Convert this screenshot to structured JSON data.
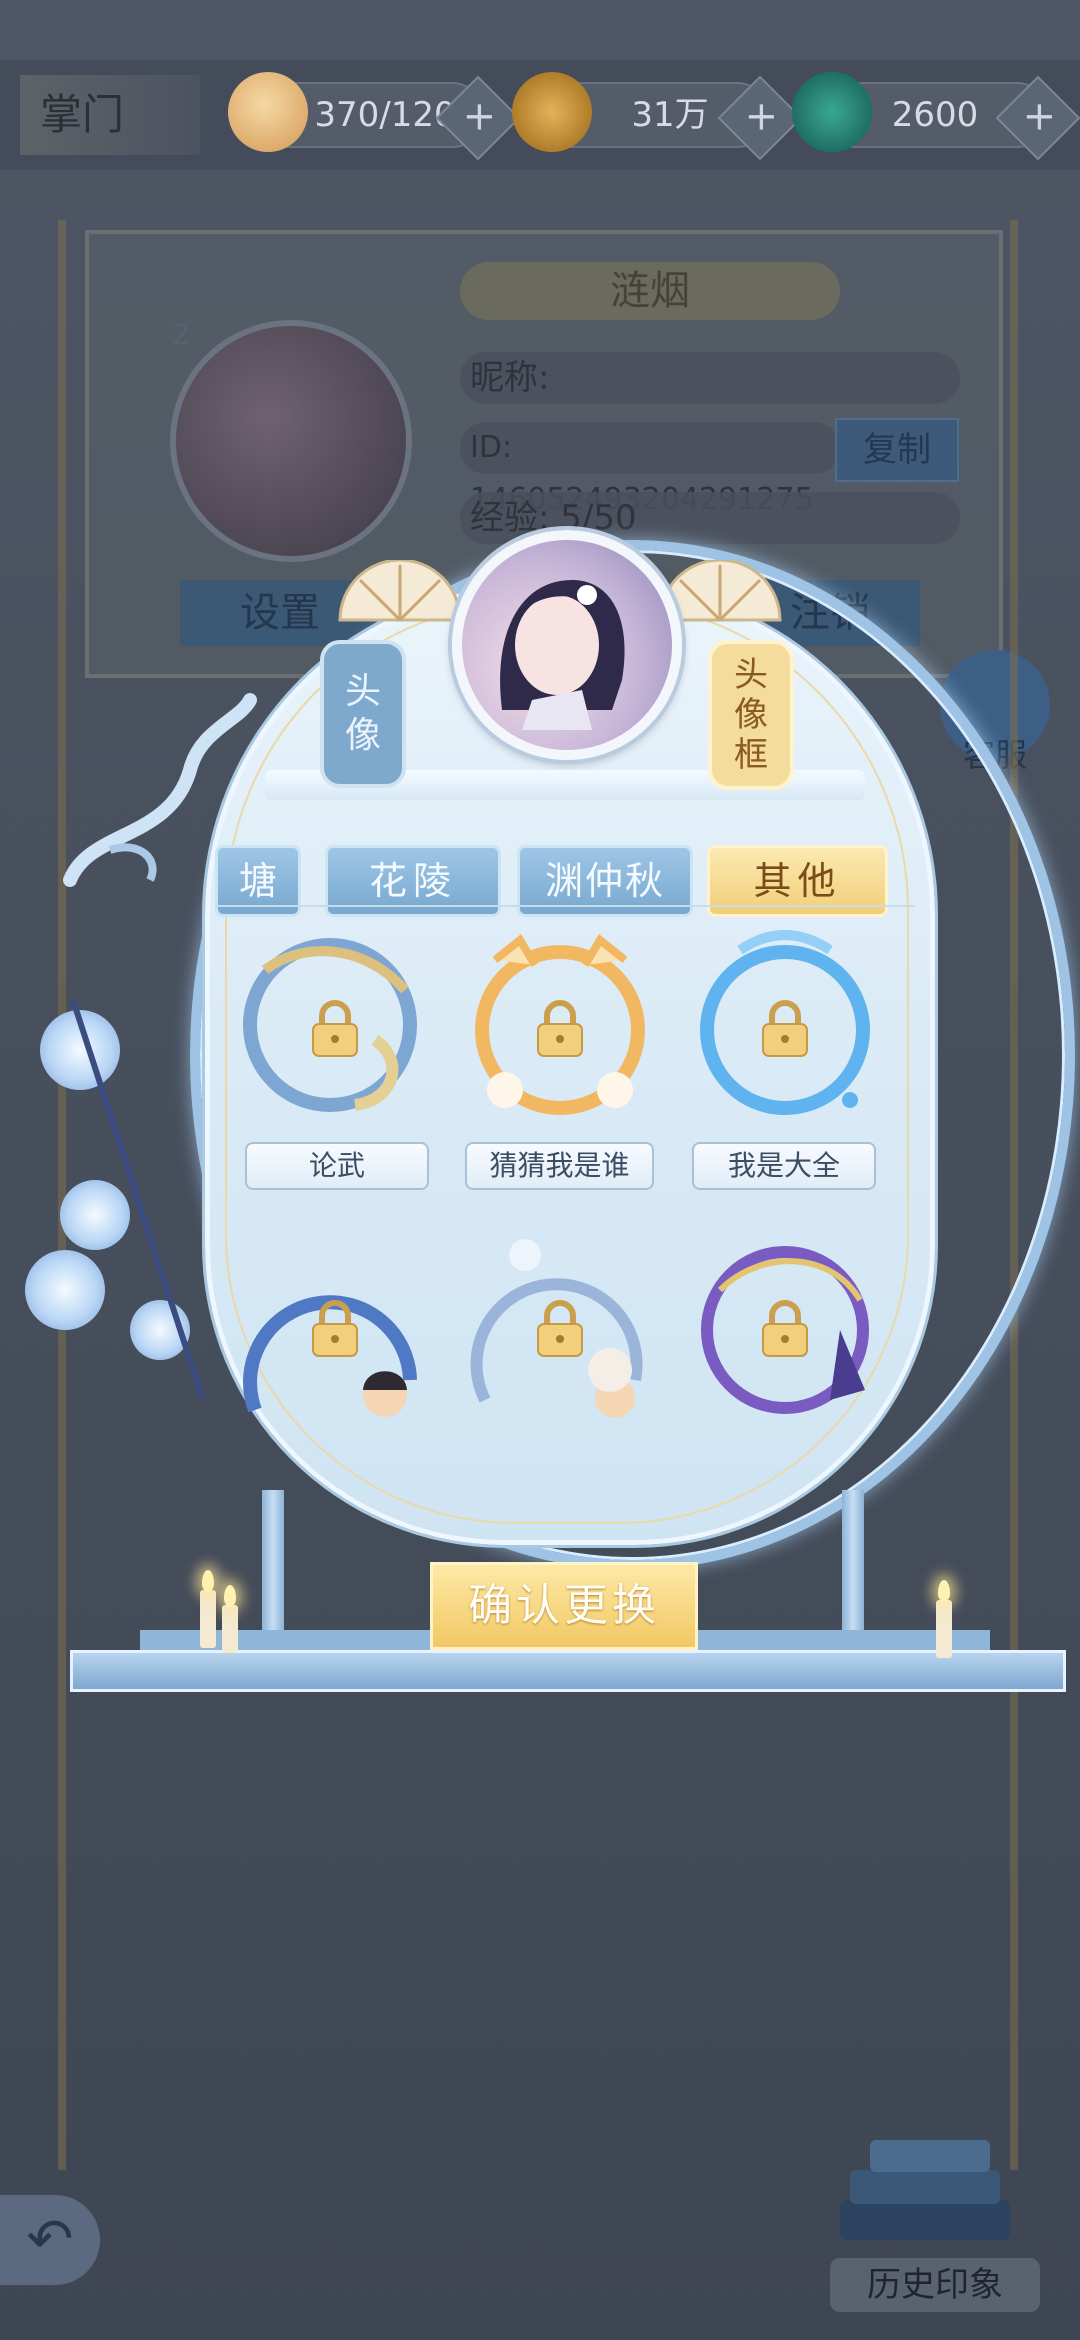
{
  "header": {
    "section_title": "掌门",
    "stamina_value": "370/120",
    "coins_value": "31万",
    "jade_value": "2600",
    "plus": "+"
  },
  "profile": {
    "name": "涟烟",
    "level": "2",
    "nickname_label": "昵称:",
    "id_label": "ID: 146052493204291275",
    "copy_label": "复制",
    "exp_label": "经验: 5/50",
    "settings_label": "设置",
    "logout_label": "注销",
    "server_label": "客服"
  },
  "modal": {
    "tag_avatar": [
      "头",
      "像"
    ],
    "tag_frame": [
      "头",
      "像",
      "框"
    ],
    "tabs": [
      {
        "label": "塘",
        "active": false
      },
      {
        "label": "花陵",
        "active": false
      },
      {
        "label": "渊仲秋",
        "active": false
      },
      {
        "label": "其他",
        "active": true
      }
    ],
    "frames": [
      {
        "label": "论武",
        "locked": true,
        "color": "#d9c286"
      },
      {
        "label": "猜猜我是谁",
        "locked": true,
        "color": "#f0b25c"
      },
      {
        "label": "我是大全",
        "locked": true,
        "color": "#5fb3ee"
      },
      {
        "label": "",
        "locked": true,
        "color": "#4f79c4"
      },
      {
        "label": "",
        "locked": true,
        "color": "#9bb4da"
      },
      {
        "label": "",
        "locked": true,
        "color": "#7a5bc2"
      }
    ],
    "confirm_label": "确认更换"
  },
  "footer": {
    "history_label": "历史印象",
    "back_icon": "back-arrow-icon"
  },
  "colors": {
    "accent_gold": "#f2c864",
    "accent_blue": "#78a8d0"
  }
}
